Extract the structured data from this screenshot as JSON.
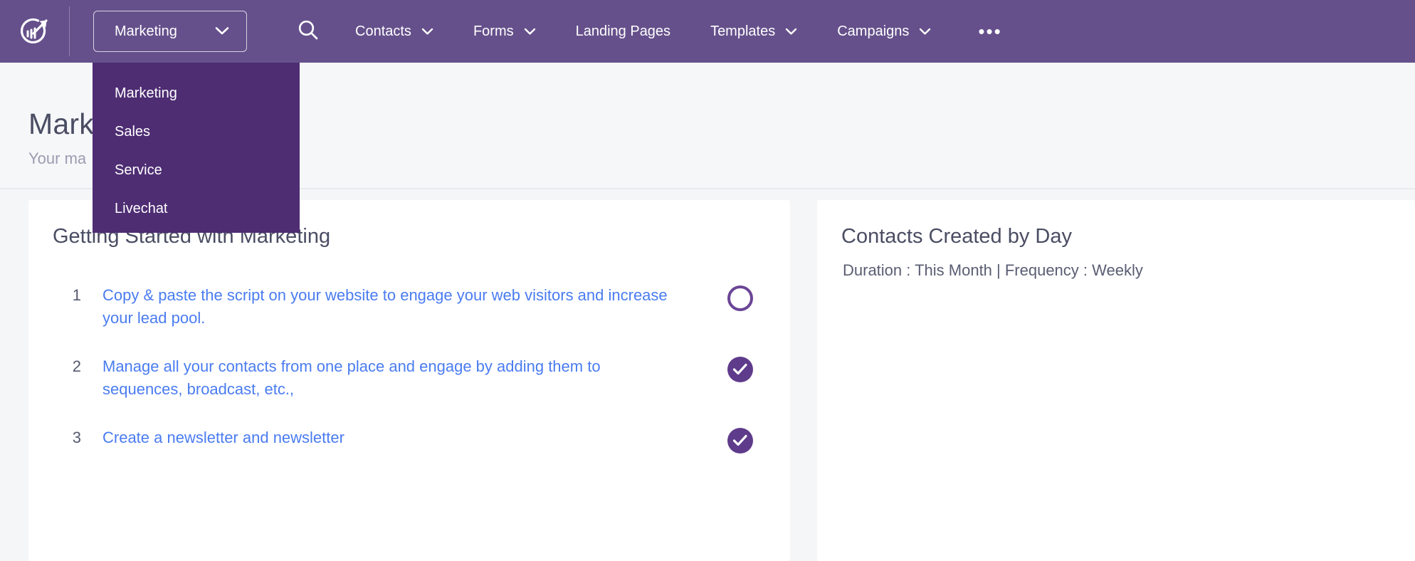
{
  "header": {
    "logo_name": "engagebay-logo",
    "app_switcher": {
      "label": "Marketing",
      "chevron": "chevron-down-icon"
    },
    "search_icon": "search-icon",
    "nav_items": [
      {
        "label": "Contacts",
        "has_chevron": true
      },
      {
        "label": "Forms",
        "has_chevron": true
      },
      {
        "label": "Landing Pages",
        "has_chevron": false
      },
      {
        "label": "Templates",
        "has_chevron": true
      },
      {
        "label": "Campaigns",
        "has_chevron": true
      }
    ],
    "overflow": {
      "label": "•••",
      "name": "more-menu-icon"
    },
    "bar_color": "#65508b"
  },
  "dropdown": {
    "open": true,
    "bg_color": "#4e2d73",
    "items": [
      {
        "label": "Marketing"
      },
      {
        "label": "Sales"
      },
      {
        "label": "Service"
      },
      {
        "label": "Livechat"
      }
    ]
  },
  "page": {
    "title": "Marketing",
    "title_chevron": "chevron-down-icon",
    "subtitle": "Your ma"
  },
  "getting_started": {
    "title": "Getting Started with Marketing",
    "items": [
      {
        "number": "1",
        "text": "Copy & paste the script on your website to engage your web visitors and increase your lead pool.",
        "status": "open"
      },
      {
        "number": "2",
        "text": "Manage all your contacts from one place and engage by adding them to sequences, broadcast, etc.,",
        "status": "done"
      },
      {
        "number": "3",
        "text": "Create a newsletter and newsletter",
        "status": "done"
      }
    ],
    "link_color": "#4a7cf0",
    "accent_color": "#5f3b8b"
  },
  "contacts_chart": {
    "title": "Contacts Created by Day",
    "meta": "Duration : This Month | Frequency : Weekly"
  }
}
